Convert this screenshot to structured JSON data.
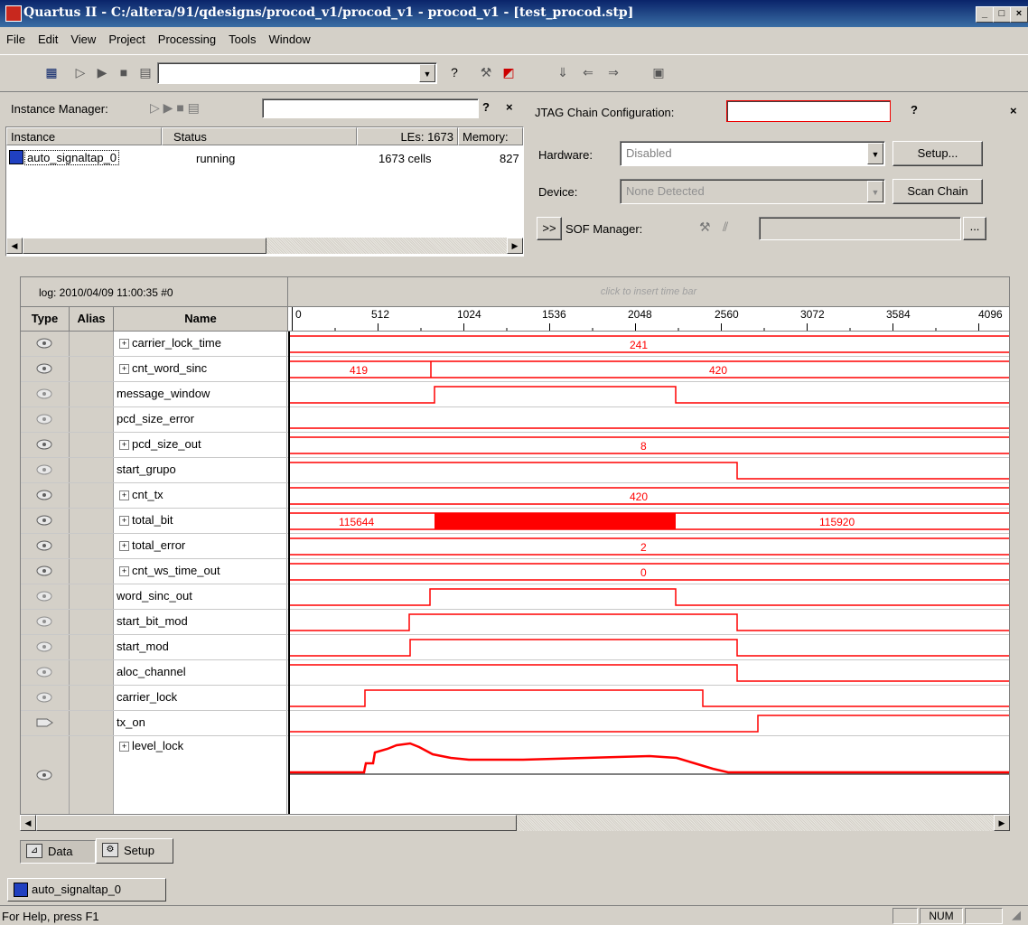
{
  "window": {
    "title": "Quartus II - C:/altera/91/qdesigns/procod_v1/procod_v1 - procod_v1 - [test_procod.stp]"
  },
  "menu": [
    "File",
    "Edit",
    "View",
    "Project",
    "Processing",
    "Tools",
    "Window"
  ],
  "instance_manager": {
    "label": "Instance Manager:",
    "columns": {
      "instance": "Instance",
      "status": "Status",
      "les": "LEs: 1673",
      "memory": "Memory:"
    },
    "row": {
      "instance": "auto_signaltap_0",
      "status": "running",
      "les": "1673 cells",
      "memory": "827"
    }
  },
  "jtag": {
    "label": "JTAG Chain Configuration:",
    "hardware_label": "Hardware:",
    "hardware_value": "Disabled",
    "setup_button": "Setup...",
    "device_label": "Device:",
    "device_value": "None Detected",
    "scan_button": "Scan Chain",
    "expand_button": ">>",
    "sof_label": "SOF Manager:",
    "browse_button": "..."
  },
  "waveform": {
    "log_label": "log: 2010/04/09 11:00:35  #0",
    "time_bar_hint": "click to insert time bar",
    "columns": {
      "type": "Type",
      "alias": "Alias",
      "name": "Name"
    },
    "ruler": [
      "0",
      "512",
      "1024",
      "1536",
      "2048",
      "2560",
      "3072",
      "3584",
      "4096"
    ],
    "signal_color": "#ff0000",
    "signals": [
      {
        "name": "carrier_lock_time",
        "bus": true,
        "values": [
          "241"
        ]
      },
      {
        "name": "cnt_word_sinc",
        "bus": true,
        "values": [
          "419",
          "420"
        ]
      },
      {
        "name": "message_window",
        "bus": false
      },
      {
        "name": "pcd_size_error",
        "bus": false
      },
      {
        "name": "pcd_size_out",
        "bus": true,
        "values": [
          "8"
        ]
      },
      {
        "name": "start_grupo",
        "bus": false
      },
      {
        "name": "cnt_tx",
        "bus": true,
        "values": [
          "420"
        ]
      },
      {
        "name": "total_bit",
        "bus": true,
        "values": [
          "115644",
          "115920"
        ]
      },
      {
        "name": "total_error",
        "bus": true,
        "values": [
          "2"
        ]
      },
      {
        "name": "cnt_ws_time_out",
        "bus": true,
        "values": [
          "0"
        ]
      },
      {
        "name": "word_sinc_out",
        "bus": false
      },
      {
        "name": "start_bit_mod",
        "bus": false
      },
      {
        "name": "start_mod",
        "bus": false
      },
      {
        "name": "aloc_channel",
        "bus": false
      },
      {
        "name": "carrier_lock",
        "bus": false
      },
      {
        "name": "tx_on",
        "bus": false
      },
      {
        "name": "level_lock",
        "bus": true
      }
    ]
  },
  "tabs": {
    "data": "Data",
    "setup": "Setup"
  },
  "instance_tab": "auto_signaltap_0",
  "status": {
    "help": "For Help, press F1",
    "num": "NUM"
  }
}
